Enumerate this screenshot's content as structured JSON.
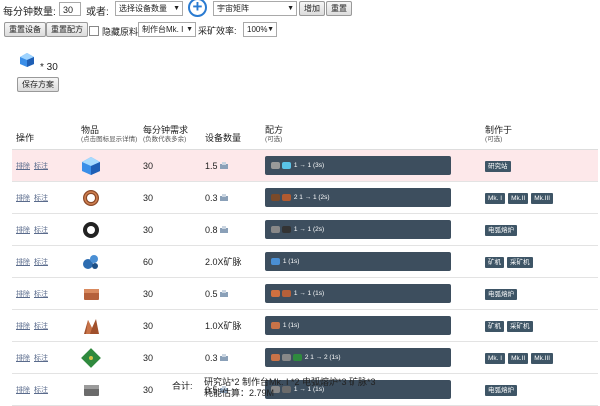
{
  "controls": {
    "per_minute_label": "每分钟数量:",
    "per_minute_value": "30",
    "or_label": "或者:",
    "device_select": "选择设备数量",
    "product_select": "宇宙矩阵",
    "add_label": "增加",
    "reset_label": "重置",
    "reset_device_label": "重置设备",
    "reset_recipe_label": "重置配方",
    "hide_raw_label": "隐藏原料",
    "workshop_select": "制作台Mk. I",
    "mining_eff_label": "采矿效率:",
    "mining_eff_value": "100%"
  },
  "summary": {
    "qty": "* 30",
    "save_label": "保存方案"
  },
  "table": {
    "headers": {
      "op": "操作",
      "item": "物品",
      "item_sub": "(点击图标显示详情)",
      "demand": "每分钟需求",
      "demand_sub": "(负数代表多余)",
      "count": "设备数量",
      "recipe": "配方",
      "recipe_sub": "(可选)",
      "made_in": "制作于",
      "made_in_sub": "(可选)"
    },
    "op_remove": "排除",
    "op_mark": "标注",
    "rows": [
      {
        "demand": "30",
        "count": "1.5",
        "recipe": "1 → 1 (3s)",
        "buildings": [
          "研究站"
        ],
        "hl": true,
        "icon": "cube"
      },
      {
        "demand": "30",
        "count": "0.3",
        "recipe": "2 1 → 1 (2s)",
        "buildings": [
          "Mk. I",
          "Mk.II",
          "Mk.III"
        ],
        "icon": "coil"
      },
      {
        "demand": "30",
        "count": "0.8",
        "recipe": "1 → 1 (2s)",
        "buildings": [
          "电弧熔炉"
        ],
        "icon": "magnet"
      },
      {
        "demand": "60",
        "count": "2.0X矿脉",
        "recipe": "1 (1s)",
        "buildings": [
          "矿机",
          "采矿机"
        ],
        "icon": "ore"
      },
      {
        "demand": "30",
        "count": "0.5",
        "recipe": "1 → 1 (1s)",
        "buildings": [
          "电弧熔炉"
        ],
        "icon": "copper"
      },
      {
        "demand": "30",
        "count": "1.0X矿脉",
        "recipe": "1 (1s)",
        "buildings": [
          "矿机",
          "采矿机"
        ],
        "icon": "copperore"
      },
      {
        "demand": "30",
        "count": "0.3",
        "recipe": "2 1 → 2 (1s)",
        "buildings": [
          "Mk. I",
          "Mk.II",
          "Mk.III"
        ],
        "icon": "board"
      },
      {
        "demand": "30",
        "count": "0.5",
        "recipe": "1 → 1 (1s)",
        "buildings": [
          "电弧熔炉"
        ],
        "icon": "iron"
      }
    ]
  },
  "footer": {
    "total_label": "合计:",
    "total_buildings": "研究站*2 制作台Mk. I *2 电弧熔炉*3 矿脉*3",
    "power": "耗能估算：2.79M"
  }
}
